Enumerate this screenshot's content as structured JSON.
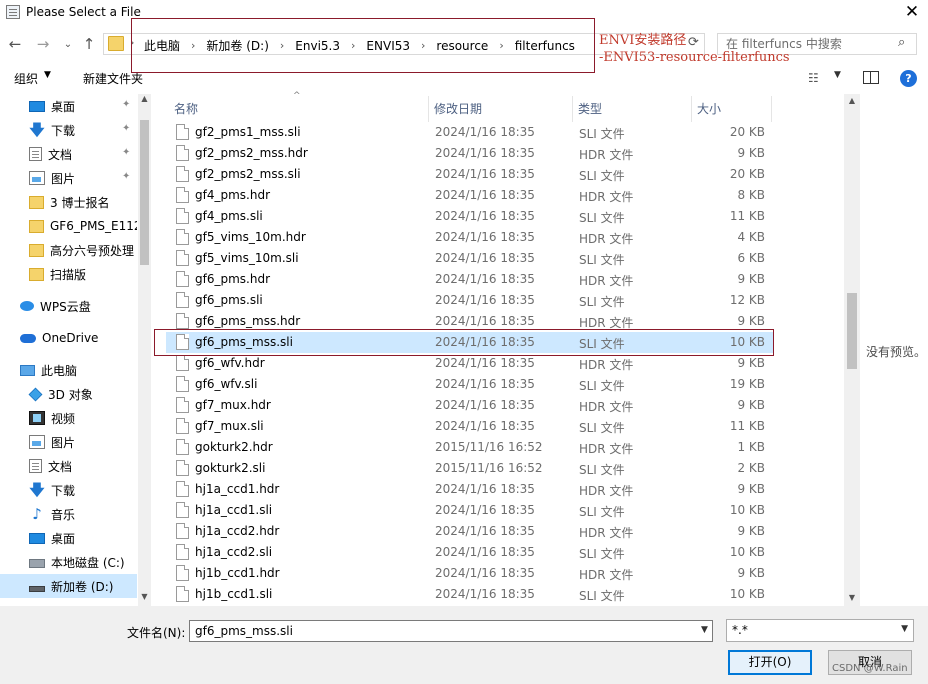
{
  "window": {
    "title": "Please Select a File",
    "close_glyph": "✕"
  },
  "nav": {
    "back_glyph": "←",
    "forward_glyph": "→",
    "recent_glyph": "⌄",
    "up_glyph": "↑",
    "first_arrow": "›",
    "breadcrumb": [
      "此电脑",
      "新加卷 (D:)",
      "Envi5.3",
      "ENVI53",
      "resource",
      "filterfuncs"
    ],
    "crumb_sep": "›",
    "refresh_glyph": "⟳",
    "search_placeholder": "在 filterfuncs 中搜索",
    "search_glyph": "⌕"
  },
  "annotation": {
    "line1": "ENVI安装路径",
    "line2": "-ENVI53-resource-filterfuncs",
    "color": "#c0392b"
  },
  "toolbar": {
    "organize_label": "组织",
    "dropdown_arrow": "▼",
    "new_folder_label": "新建文件夹",
    "view_glyph": "☷"
  },
  "help": {
    "glyph": "?"
  },
  "sidebar": {
    "pin_glyph": "📌",
    "items": [
      {
        "label": "桌面",
        "icon": "desktop-icon",
        "pinned": true
      },
      {
        "label": "下载",
        "icon": "download-icon",
        "pinned": true
      },
      {
        "label": "文档",
        "icon": "documents-icon",
        "pinned": true
      },
      {
        "label": "图片",
        "icon": "pictures-icon",
        "pinned": true
      },
      {
        "label": "3 博士报名",
        "icon": "folder-icon"
      },
      {
        "label": "GF6_PMS_E112",
        "icon": "folder-icon"
      },
      {
        "label": "高分六号预处理",
        "icon": "folder-icon"
      },
      {
        "label": "扫描版",
        "icon": "folder-icon"
      },
      {
        "label": "WPS云盘",
        "icon": "wps-cloud-icon"
      },
      {
        "label": "OneDrive",
        "icon": "onedrive-icon"
      },
      {
        "label": "此电脑",
        "icon": "this-pc-icon"
      },
      {
        "label": "3D 对象",
        "icon": "3d-objects-icon"
      },
      {
        "label": "视频",
        "icon": "videos-icon"
      },
      {
        "label": "图片",
        "icon": "pictures-icon"
      },
      {
        "label": "文档",
        "icon": "documents-icon"
      },
      {
        "label": "下载",
        "icon": "download-icon"
      },
      {
        "label": "音乐",
        "icon": "music-icon"
      },
      {
        "label": "桌面",
        "icon": "desktop-icon"
      },
      {
        "label": "本地磁盘 (C:)",
        "icon": "local-disk-icon"
      },
      {
        "label": "新加卷 (D:)",
        "icon": "drive-icon",
        "selected": true
      }
    ],
    "scroll_up": "▲",
    "scroll_down": "▼"
  },
  "columns": {
    "name": "名称",
    "modified": "修改日期",
    "type": "类型",
    "size": "大小",
    "sort_glyph": "^"
  },
  "files": [
    {
      "name": "gf2_pms1_mss.sli",
      "date": "2024/1/16 18:35",
      "type": "SLI 文件",
      "size": "20 KB"
    },
    {
      "name": "gf2_pms2_mss.hdr",
      "date": "2024/1/16 18:35",
      "type": "HDR 文件",
      "size": "9 KB"
    },
    {
      "name": "gf2_pms2_mss.sli",
      "date": "2024/1/16 18:35",
      "type": "SLI 文件",
      "size": "20 KB"
    },
    {
      "name": "gf4_pms.hdr",
      "date": "2024/1/16 18:35",
      "type": "HDR 文件",
      "size": "8 KB"
    },
    {
      "name": "gf4_pms.sli",
      "date": "2024/1/16 18:35",
      "type": "SLI 文件",
      "size": "11 KB"
    },
    {
      "name": "gf5_vims_10m.hdr",
      "date": "2024/1/16 18:35",
      "type": "HDR 文件",
      "size": "4 KB"
    },
    {
      "name": "gf5_vims_10m.sli",
      "date": "2024/1/16 18:35",
      "type": "SLI 文件",
      "size": "6 KB"
    },
    {
      "name": "gf6_pms.hdr",
      "date": "2024/1/16 18:35",
      "type": "HDR 文件",
      "size": "9 KB"
    },
    {
      "name": "gf6_pms.sli",
      "date": "2024/1/16 18:35",
      "type": "SLI 文件",
      "size": "12 KB"
    },
    {
      "name": "gf6_pms_mss.hdr",
      "date": "2024/1/16 18:35",
      "type": "HDR 文件",
      "size": "9 KB"
    },
    {
      "name": "gf6_pms_mss.sli",
      "date": "2024/1/16 18:35",
      "type": "SLI 文件",
      "size": "10 KB",
      "selected": true
    },
    {
      "name": "gf6_wfv.hdr",
      "date": "2024/1/16 18:35",
      "type": "HDR 文件",
      "size": "9 KB"
    },
    {
      "name": "gf6_wfv.sli",
      "date": "2024/1/16 18:35",
      "type": "SLI 文件",
      "size": "19 KB"
    },
    {
      "name": "gf7_mux.hdr",
      "date": "2024/1/16 18:35",
      "type": "HDR 文件",
      "size": "9 KB"
    },
    {
      "name": "gf7_mux.sli",
      "date": "2024/1/16 18:35",
      "type": "SLI 文件",
      "size": "11 KB"
    },
    {
      "name": "gokturk2.hdr",
      "date": "2015/11/16 16:52",
      "type": "HDR 文件",
      "size": "1 KB"
    },
    {
      "name": "gokturk2.sli",
      "date": "2015/11/16 16:52",
      "type": "SLI 文件",
      "size": "2 KB"
    },
    {
      "name": "hj1a_ccd1.hdr",
      "date": "2024/1/16 18:35",
      "type": "HDR 文件",
      "size": "9 KB"
    },
    {
      "name": "hj1a_ccd1.sli",
      "date": "2024/1/16 18:35",
      "type": "SLI 文件",
      "size": "10 KB"
    },
    {
      "name": "hj1a_ccd2.hdr",
      "date": "2024/1/16 18:35",
      "type": "HDR 文件",
      "size": "9 KB"
    },
    {
      "name": "hj1a_ccd2.sli",
      "date": "2024/1/16 18:35",
      "type": "SLI 文件",
      "size": "10 KB"
    },
    {
      "name": "hj1b_ccd1.hdr",
      "date": "2024/1/16 18:35",
      "type": "HDR 文件",
      "size": "9 KB"
    },
    {
      "name": "hj1b_ccd1.sli",
      "date": "2024/1/16 18:35",
      "type": "SLI 文件",
      "size": "10 KB"
    }
  ],
  "list_scroll": {
    "up": "▲",
    "down": "▼"
  },
  "preview": {
    "empty_text": "没有预览。"
  },
  "bottom": {
    "filename_label": "文件名(N):",
    "filename_value": "gf6_pms_mss.sli",
    "filename_arrow": "▼",
    "filter_value": "*.*",
    "filter_arrow": "▼",
    "open_label": "打开(O)",
    "cancel_label": "取消"
  },
  "watermark": "CSDN @W.Rain",
  "colors": {
    "selection": "#cde8ff",
    "annotation_border": "#8b1a2b",
    "accent": "#0078d7"
  }
}
